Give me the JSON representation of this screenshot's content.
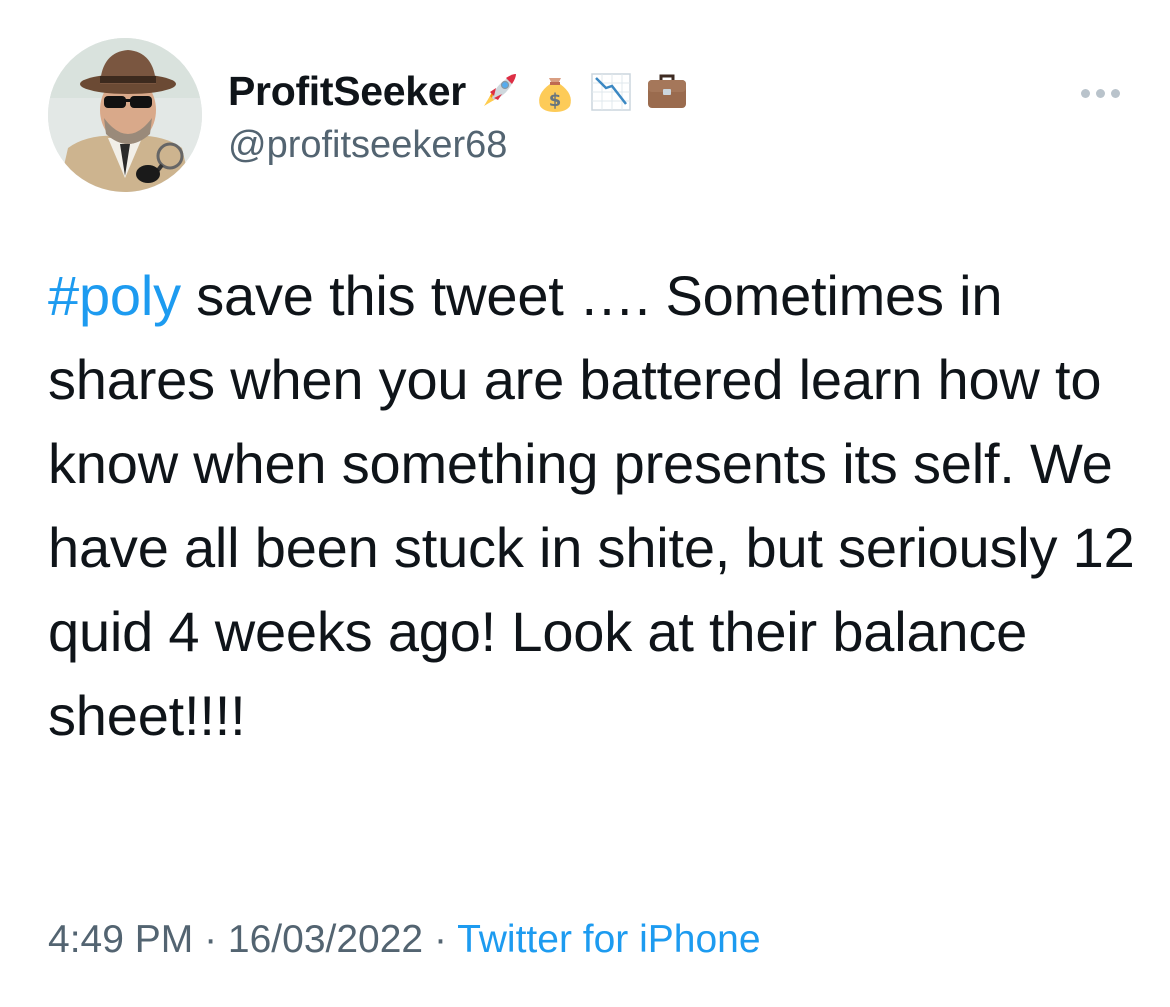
{
  "tweet": {
    "display_name": "ProfitSeeker",
    "handle": "@profitseeker68",
    "name_emojis": [
      "rocket-emoji",
      "money-bag-emoji",
      "chart-decreasing-emoji",
      "briefcase-emoji"
    ],
    "hashtag": "#poly",
    "text": " save this tweet …. Sometimes in shares when you are battered learn how to know when something presents its self. We have all been stuck in shite, but seriously 12 quid 4 weeks ago! Look at their balance sheet!!!!",
    "time": "4:49 PM",
    "separator": " · ",
    "date": "16/03/2022",
    "source": "Twitter for iPhone"
  },
  "colors": {
    "accent": "#1d9bf0",
    "text": "#0f1419",
    "secondary": "#536471",
    "more_dots": "#b9c3cb"
  }
}
